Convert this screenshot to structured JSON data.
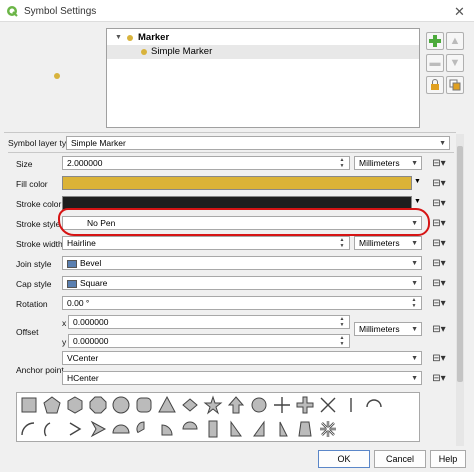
{
  "window": {
    "title": "Symbol Settings",
    "close_glyph": "✕"
  },
  "tree": {
    "root_label": "Marker",
    "child_label": "Simple Marker"
  },
  "symbol_layer_type": {
    "label": "Symbol layer type",
    "value": "Simple Marker"
  },
  "size": {
    "label": "Size",
    "value": "2.000000",
    "unit": "Millimeters"
  },
  "fill_color": {
    "label": "Fill color",
    "color": "#dbb337"
  },
  "stroke_color": {
    "label": "Stroke color",
    "color": "#1e1e1e"
  },
  "stroke_style": {
    "label": "Stroke style",
    "value": "No Pen"
  },
  "stroke_width": {
    "label": "Stroke width",
    "value": "Hairline",
    "unit": "Millimeters"
  },
  "join_style": {
    "label": "Join style",
    "value": "Bevel"
  },
  "cap_style": {
    "label": "Cap style",
    "value": "Square"
  },
  "rotation": {
    "label": "Rotation",
    "value": "0.00 °"
  },
  "offset": {
    "label": "Offset",
    "x_label": "x",
    "x_value": "0.000000",
    "y_label": "y",
    "y_value": "0.000000",
    "unit": "Millimeters"
  },
  "anchor_point": {
    "label": "Anchor point",
    "vertical": "VCenter",
    "horizontal": "HCenter"
  },
  "buttons": {
    "ok": "OK",
    "cancel": "Cancel",
    "help": "Help"
  },
  "marker_shapes": [
    "square",
    "pentagon",
    "hexagon",
    "octagon",
    "decagon",
    "rounded-square",
    "triangle",
    "diamond",
    "star",
    "filled-arrow-up",
    "circle",
    "cross",
    "cross-fill",
    "x-cross",
    "half-arc",
    "quarter-arc",
    "quarter-circle-line",
    "right-arrowhead",
    "arrowhead-shape",
    "half-circle",
    "quarter-circle",
    "third-circle",
    "rectangle-tall",
    "right-half-triangle",
    "left-half-triangle",
    "trapezoid",
    "asterisk-fill"
  ],
  "colors": {
    "accent_red": "#d61414",
    "marker_yellow": "#d8b33c"
  }
}
